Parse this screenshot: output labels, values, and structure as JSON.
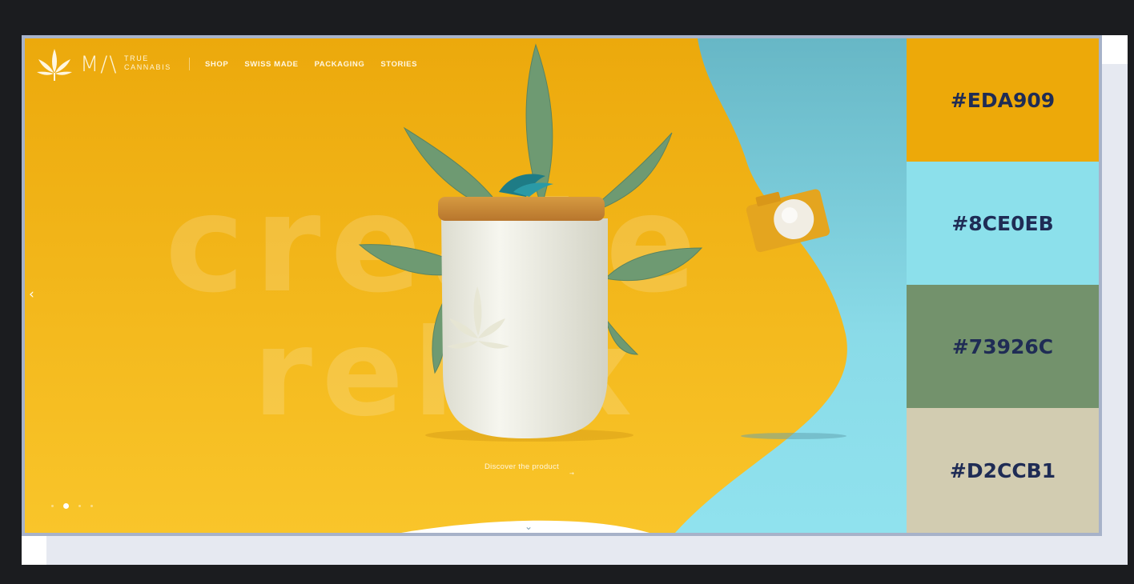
{
  "brand": {
    "mark": "M/\\",
    "line1": "TRUE",
    "line2": "CANNABIS"
  },
  "nav": {
    "items": [
      "SHOP",
      "SWISS MADE",
      "PACKAGING",
      "STORIES"
    ]
  },
  "hero": {
    "word1": "create",
    "word2": "relax",
    "cta": "Discover the product",
    "slides": 4,
    "active_slide": 2
  },
  "palette": [
    {
      "label": "#EDA909",
      "color": "#eda909"
    },
    {
      "label": "#8CE0EB",
      "color": "#8ce0eb"
    },
    {
      "label": "#73926C",
      "color": "#73926c"
    },
    {
      "label": "#D2CCB1",
      "color": "#d2ccb1"
    }
  ],
  "icons": {
    "prev": "chevron-left-icon",
    "scroll": "chevron-down-icon",
    "logo": "cannabis-leaf-icon"
  }
}
